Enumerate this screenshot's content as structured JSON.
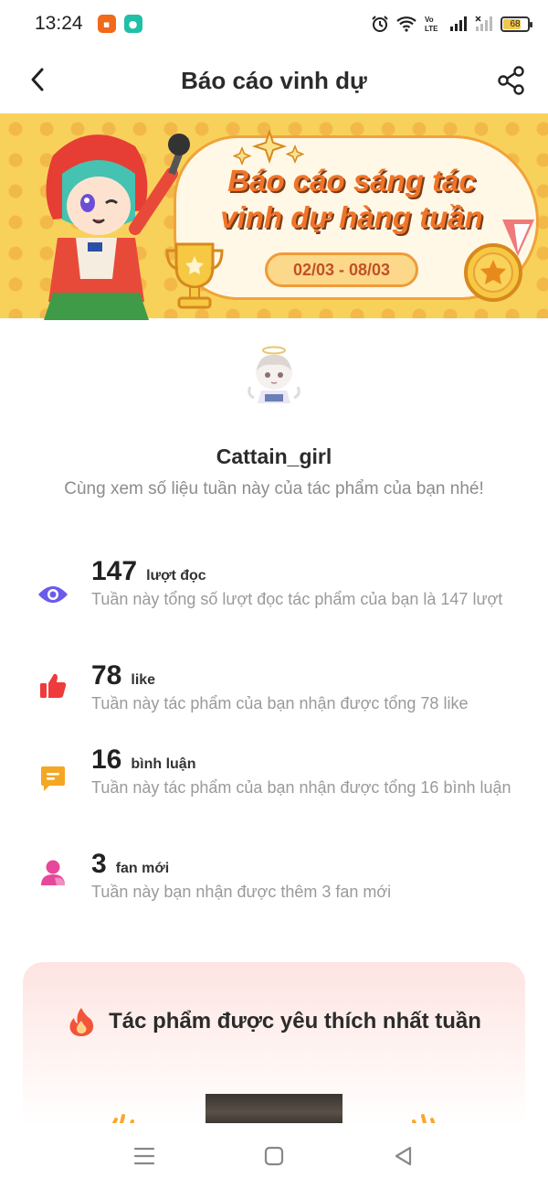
{
  "status_bar": {
    "time": "13:24",
    "app_badges": [
      "app-notification-orange",
      "app-notification-teal"
    ],
    "battery_level": "68",
    "icons": [
      "alarm-icon",
      "wifi-icon",
      "volte-icon",
      "signal-icon",
      "signal-weak-icon",
      "battery-icon"
    ]
  },
  "header": {
    "title": "Báo cáo vinh dự",
    "back_icon": "chevron-left-icon",
    "share_icon": "share-icon"
  },
  "banner": {
    "title_line1": "Báo cáo sáng tác",
    "title_line2": "vinh dự hàng tuần",
    "date_range": "02/03 - 08/03"
  },
  "profile": {
    "username": "Cattain_girl",
    "subtitle": "Cùng xem số liệu tuần này của tác phẩm của bạn nhé!"
  },
  "stats": [
    {
      "icon": "eye-icon",
      "value": "147",
      "unit": "lượt đọc",
      "description": "Tuần này tổng số lượt đọc tác phẩm của bạn là 147 lượt",
      "color": "#6b5bea"
    },
    {
      "icon": "thumbs-up-icon",
      "value": "78",
      "unit": "like",
      "description": "Tuần này tác phẩm của bạn nhận được tổng 78 like",
      "color": "#ef3b3b"
    },
    {
      "icon": "comment-icon",
      "value": "16",
      "unit": "bình luận",
      "description": "Tuần này tác phẩm của bạn nhận được tổng 16 bình luận",
      "color": "#f5a623"
    },
    {
      "icon": "user-icon",
      "value": "3",
      "unit": "fan mới",
      "description": "Tuần này bạn nhận được thêm 3 fan mới",
      "color": "#e8489a"
    }
  ],
  "favorite": {
    "title": "Tác phẩm được yêu thích nhất tuần",
    "icon": "fire-icon"
  },
  "nav_bar": {
    "icons": [
      "menu-icon",
      "home-square-icon",
      "back-triangle-icon"
    ]
  }
}
